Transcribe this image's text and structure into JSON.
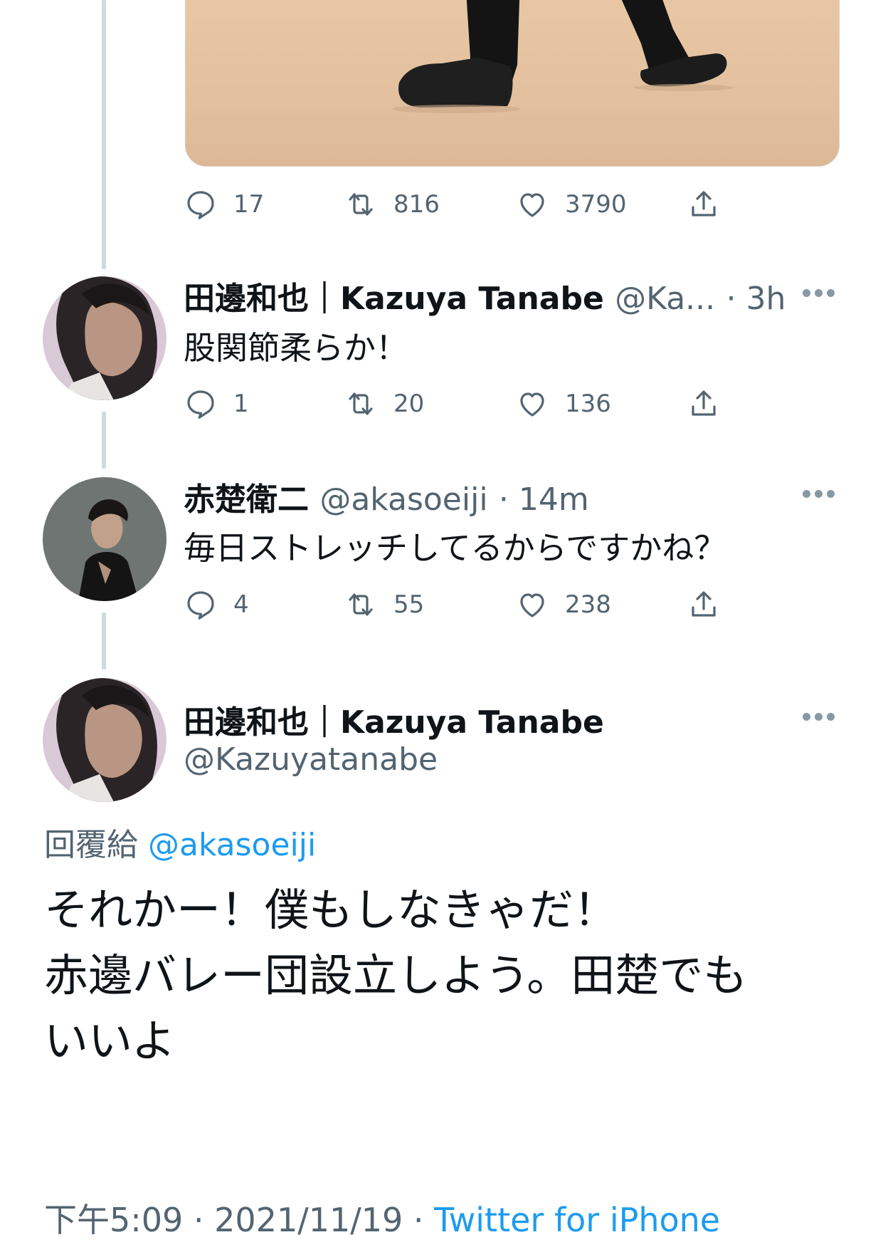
{
  "colors": {
    "accent": "#1d9bf0",
    "secondary_text": "#536471",
    "thread_line": "#cfd9de"
  },
  "first_tweet": {
    "media_image": "photo of person in black trousers and black shoes on beige background",
    "actions": {
      "reply_count": "17",
      "retweet_count": "816",
      "like_count": "3790"
    }
  },
  "tweet2": {
    "display_name": "田邊和也｜Kazuya Tanabe",
    "handle": "@Ka...",
    "time": "· 3h",
    "text": "股関節柔らか！",
    "actions": {
      "reply_count": "1",
      "retweet_count": "20",
      "like_count": "136"
    }
  },
  "tweet3": {
    "display_name": "赤楚衛二",
    "handle": "@akasoeiji",
    "time": "· 14m",
    "text": "毎日ストレッチしてるからですかね？",
    "actions": {
      "reply_count": "4",
      "retweet_count": "55",
      "like_count": "238"
    }
  },
  "main_tweet": {
    "display_name": "田邊和也｜Kazuya Tanabe",
    "handle": "@Kazuyatanabe",
    "replying_label": "回覆給",
    "replying_to": "@akasoeiji",
    "text_line1": "それかー！僕もしなきゃだ！",
    "text_line2": "赤邊バレー団設立しよう。田楚でも",
    "text_line3": "いいよ",
    "timestamp": "下午5:09 · 2021/11/19 · ",
    "source": "Twitter for iPhone"
  },
  "icons": [
    "reply-icon",
    "retweet-icon",
    "like-icon",
    "share-icon",
    "more-icon",
    "avatar"
  ]
}
